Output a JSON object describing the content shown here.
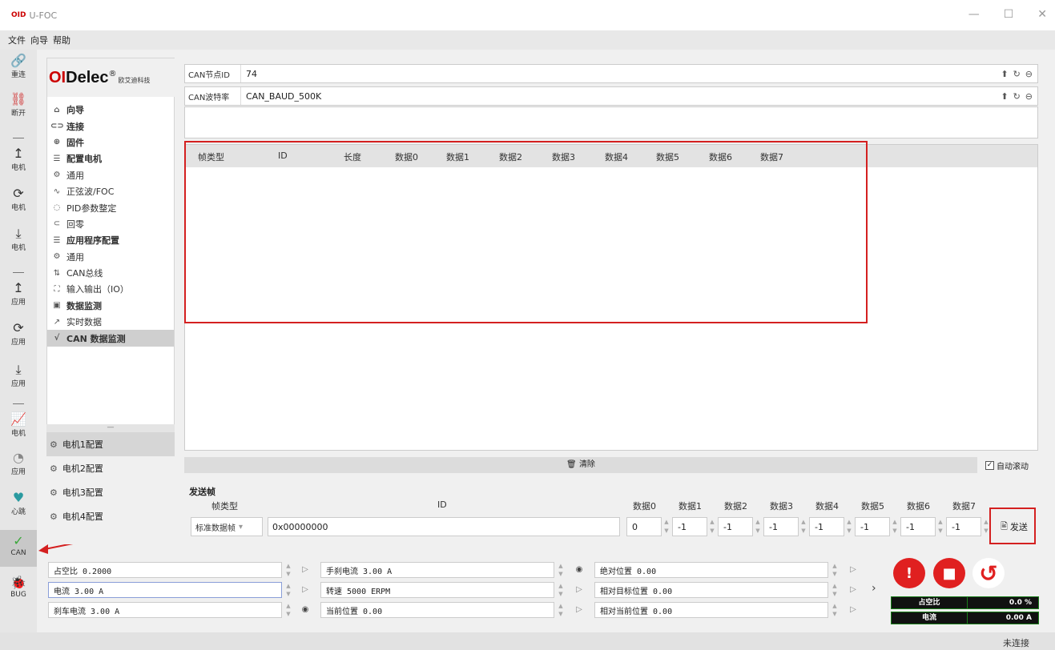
{
  "window": {
    "logo": "OID",
    "title": "U-FOC",
    "minimize": "—",
    "maximize": "☐",
    "close": "✕"
  },
  "menu": [
    "文件",
    "向导",
    "帮助"
  ],
  "leftbar": [
    {
      "icon": "🔗",
      "label": "重连",
      "color": "#3aa83a"
    },
    {
      "icon": "⛓",
      "label": "断开",
      "color": "#d03030"
    },
    {
      "icon": "↥",
      "label": "电机",
      "color": "#333"
    },
    {
      "icon": "⟳",
      "label": "电机",
      "color": "#333"
    },
    {
      "icon": "⤓",
      "label": "电机",
      "color": "#333"
    },
    {
      "icon": "↥",
      "label": "应用",
      "color": "#333"
    },
    {
      "icon": "⟳",
      "label": "应用",
      "color": "#333"
    },
    {
      "icon": "⤓",
      "label": "应用",
      "color": "#333"
    },
    {
      "icon": "📈",
      "label": "电机",
      "color": "#333"
    },
    {
      "icon": "◔",
      "label": "应用",
      "color": "#888"
    },
    {
      "icon": "♥",
      "label": "心跳",
      "color": "#2a9aa0"
    },
    {
      "icon": "✓",
      "label": "CAN",
      "color": "#3aa83a"
    },
    {
      "icon": "🐞",
      "label": "BUG",
      "color": "#333"
    }
  ],
  "brand": {
    "part1": "OI",
    "part2": "Delec",
    "reg": "®",
    "sub": "欧艾迪科技"
  },
  "nav": [
    {
      "icon": "⌂",
      "label": "向导",
      "bold": true
    },
    {
      "icon": "⊂⊃",
      "label": "连接",
      "bold": true
    },
    {
      "icon": "⊕",
      "label": "固件",
      "bold": true
    },
    {
      "icon": "☰",
      "label": "配置电机",
      "bold": true
    },
    {
      "icon": "⚙",
      "label": "通用",
      "bold": false
    },
    {
      "icon": "∿",
      "label": "正弦波/FOC",
      "bold": false
    },
    {
      "icon": "◌",
      "label": "PID参数整定",
      "bold": false
    },
    {
      "icon": "⊂",
      "label": "回零",
      "bold": false
    },
    {
      "icon": "☰",
      "label": "应用程序配置",
      "bold": true
    },
    {
      "icon": "⚙",
      "label": "通用",
      "bold": false
    },
    {
      "icon": "⇅",
      "label": "CAN总线",
      "bold": false
    },
    {
      "icon": "⛶",
      "label": "输入输出（IO）",
      "bold": false
    },
    {
      "icon": "▣",
      "label": "数据监测",
      "bold": true
    },
    {
      "icon": "↗",
      "label": "实时数据",
      "bold": false
    },
    {
      "icon": "√",
      "label": "CAN 数据监测",
      "bold": true,
      "selected": true
    }
  ],
  "motors": [
    "电机1配置",
    "电机2配置",
    "电机3配置",
    "电机4配置"
  ],
  "can_node_id": {
    "label": "CAN节点ID",
    "value": "74"
  },
  "can_baud": {
    "label": "CAN波特率",
    "value": "CAN_BAUD_500K"
  },
  "table_headers": [
    "帧类型",
    "ID",
    "长度",
    "数据0",
    "数据1",
    "数据2",
    "数据3",
    "数据4",
    "数据5",
    "数据6",
    "数据7"
  ],
  "clear_label": "清除",
  "auto_scroll": {
    "label": "自动滚动",
    "checked": true
  },
  "send": {
    "title": "发送帧",
    "frame_type_header": "帧类型",
    "id_header": "ID",
    "data_headers": [
      "数据0",
      "数据1",
      "数据2",
      "数据3",
      "数据4",
      "数据5",
      "数据6",
      "数据7"
    ],
    "frame_type": "标准数据帧",
    "id_value": "0x00000000",
    "data_values": [
      "0",
      "-1",
      "-1",
      "-1",
      "-1",
      "-1",
      "-1",
      "-1"
    ],
    "send_label": "发送"
  },
  "controls": [
    [
      "占空比 0.2000",
      "手刹电流 3.00 A",
      "绝对位置 0.00"
    ],
    [
      "电流 3.00 A",
      "转速 5000 ERPM",
      "相对目标位置 0.00"
    ],
    [
      "刹车电流 3.00 A",
      "当前位置 0.00",
      "相对当前位置 0.00"
    ]
  ],
  "meters": [
    {
      "label": "占空比",
      "value": "0.0 %"
    },
    {
      "label": "电流",
      "value": "0.00 A"
    }
  ],
  "status": "未连接"
}
